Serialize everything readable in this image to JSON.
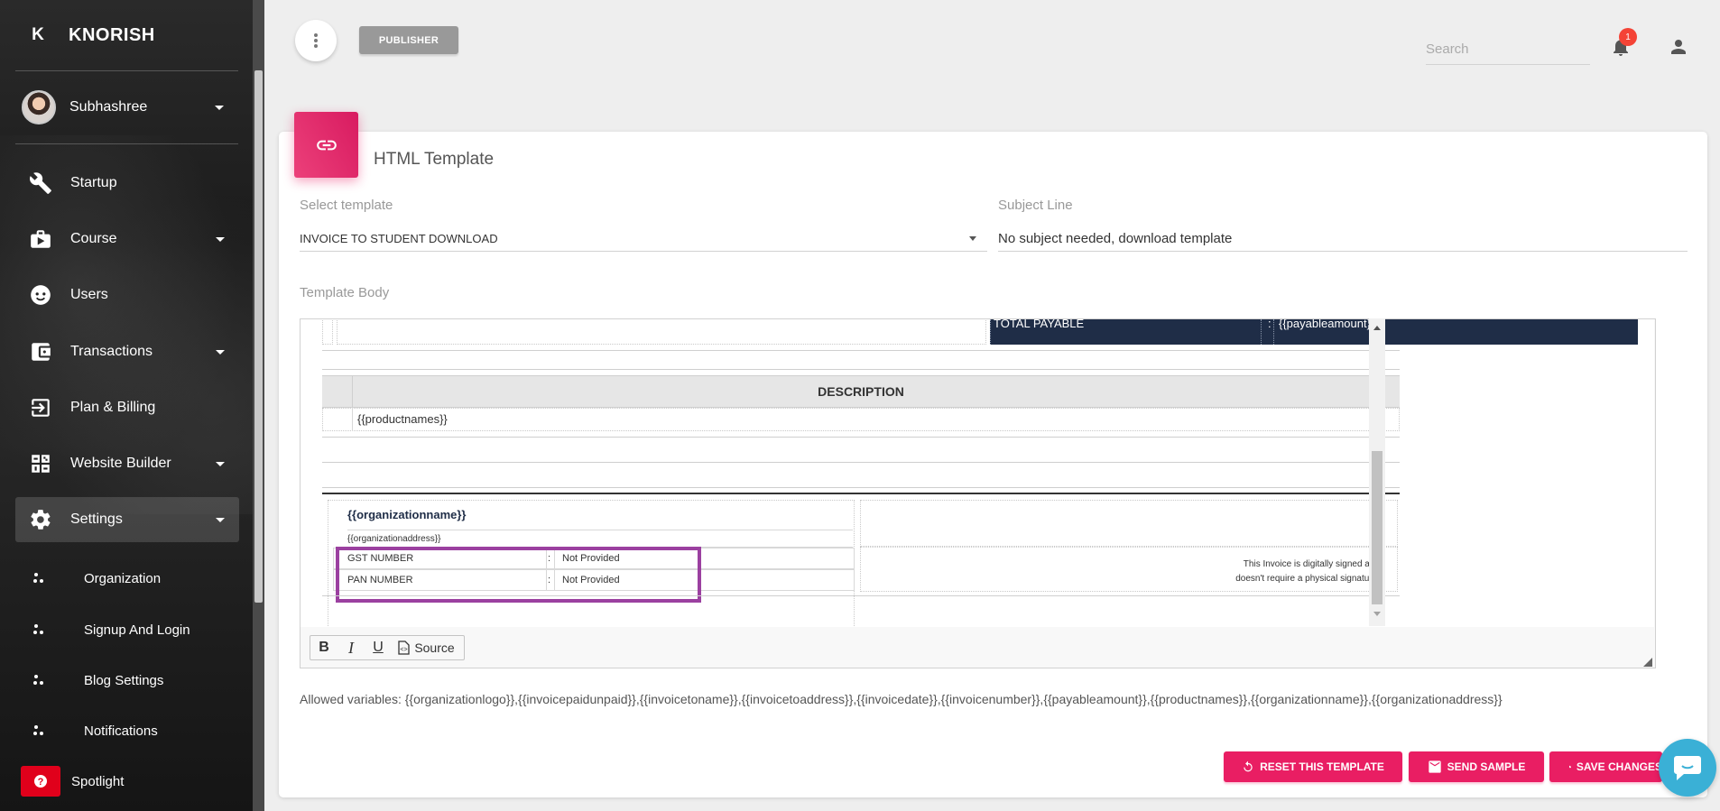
{
  "brand": {
    "mini": "K",
    "name": "KNORISH"
  },
  "user": {
    "name": "Subhashree"
  },
  "nav": [
    {
      "label": "Startup",
      "icon": "wrench-icon",
      "caret": false
    },
    {
      "label": "Course",
      "icon": "briefcase-icon",
      "caret": true
    },
    {
      "label": "Users",
      "icon": "face-icon",
      "caret": false
    },
    {
      "label": "Transactions",
      "icon": "wallet-icon",
      "caret": true
    },
    {
      "label": "Plan & Billing",
      "icon": "login-arrow-icon",
      "caret": false
    },
    {
      "label": "Website Builder",
      "icon": "puzzle-icon",
      "caret": true
    },
    {
      "label": "Settings",
      "icon": "gear-icon",
      "caret": true,
      "active": true
    }
  ],
  "subnav": [
    {
      "label": "Organization"
    },
    {
      "label": "Signup And Login"
    },
    {
      "label": "Blog Settings"
    },
    {
      "label": "Notifications"
    },
    {
      "label": "Spotlight"
    }
  ],
  "topbar": {
    "publisher_label": "PUBLISHER",
    "search_placeholder": "Search",
    "notification_count": "1"
  },
  "card": {
    "title": "HTML Template",
    "select_label": "Select template",
    "select_value": "INVOICE TO STUDENT DOWNLOAD",
    "subject_label": "Subject Line",
    "subject_value": "No subject needed, download template",
    "body_label": "Template Body"
  },
  "editor": {
    "total_payable": "TOTAL PAYABLE",
    "colon": ":",
    "payable_var": "{{payableamount}}",
    "description": "DESCRIPTION",
    "productnames": "{{productnames}}",
    "orgname": "{{organizationname}}",
    "orgaddress": "{{organizationaddress}}",
    "gst_label": "GST NUMBER",
    "gst_value": "Not Provided",
    "pan_label": "PAN NUMBER",
    "pan_value": "Not Provided",
    "sign_line1": "This Invoice is digitally signed and",
    "sign_line2": "doesn't require a physical signature.",
    "toolbar": {
      "bold": "B",
      "italic": "I",
      "underline": "U",
      "source": "Source"
    }
  },
  "allowed_variables": "Allowed variables: {{organizationlogo}},{{invoicepaidunpaid}},{{invoicetoname}},{{invoicetoaddress}},{{invoicedate}},{{invoicenumber}},{{payableamount}},{{productnames}},{{organizationname}},{{organizationaddress}}",
  "buttons": {
    "reset": "RESET THIS TEMPLATE",
    "send": "SEND SAMPLE",
    "save": "SAVE CHANGES"
  },
  "colors": {
    "accent": "#e91e63",
    "navy": "#1f2d47",
    "highlight": "#9b40a0"
  }
}
